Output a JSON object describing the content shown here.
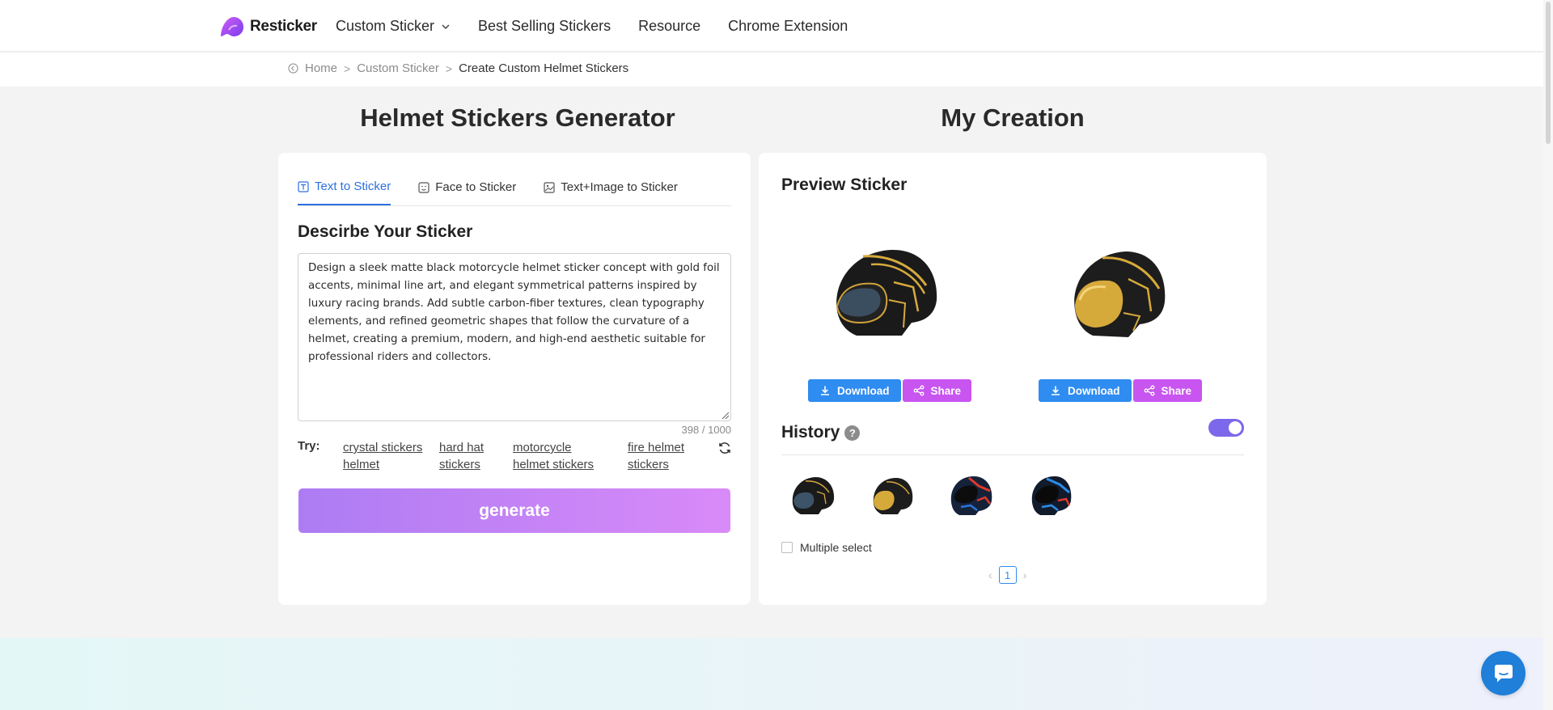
{
  "brand": {
    "name": "Resticker",
    "accent": "#c855f0",
    "primary": "#2f8cf0"
  },
  "nav": {
    "items": [
      {
        "label": "Custom Sticker",
        "has_dropdown": true
      },
      {
        "label": "Best Selling Stickers"
      },
      {
        "label": "Resource"
      },
      {
        "label": "Chrome Extension"
      }
    ]
  },
  "breadcrumb": {
    "items": [
      "Home",
      "Custom Sticker",
      "Create Custom Helmet Stickers"
    ]
  },
  "left": {
    "title": "Helmet Stickers Generator",
    "tabs": [
      {
        "label": "Text to Sticker",
        "icon": "text-icon",
        "active": true
      },
      {
        "label": "Face to Sticker",
        "icon": "face-icon"
      },
      {
        "label": "Text+Image to Sticker",
        "icon": "image-icon"
      }
    ],
    "describe_title": "Descirbe Your Sticker",
    "prompt": "Design a sleek matte black motorcycle helmet sticker concept with gold foil accents, minimal line art, and elegant symmetrical patterns inspired by luxury racing brands. Add subtle carbon-fiber textures, clean typography elements, and refined geometric shapes that follow the curvature of a helmet, creating a premium, modern, and high-end aesthetic suitable for professional riders and collectors.",
    "counter": "398 / 1000",
    "try_label": "Try:",
    "try_links": [
      "crystal stickers helmet",
      "hard hat stickers",
      "motorcycle helmet stickers",
      "fire helmet stickers"
    ],
    "generate_label": "generate"
  },
  "right": {
    "title": "My Creation",
    "preview_title": "Preview Sticker",
    "download_label": "Download",
    "share_label": "Share",
    "history_title": "History",
    "help_glyph": "?",
    "history_toggle_on": true,
    "multiple_select_label": "Multiple select",
    "page_current": "1",
    "page_prev": "‹",
    "page_next": "›"
  }
}
